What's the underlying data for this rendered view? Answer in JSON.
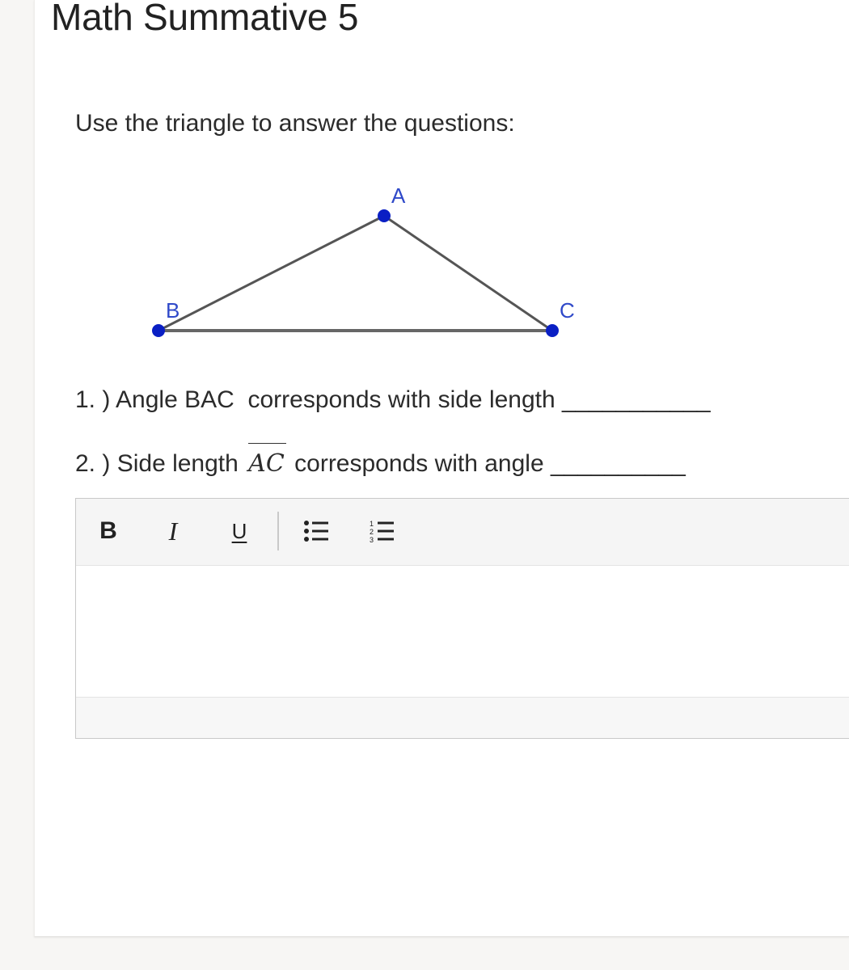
{
  "header": {
    "title": "Math Summative 5"
  },
  "prompt": {
    "instructions": "Use the triangle to answer the questions:"
  },
  "figure": {
    "vertex_labels": {
      "a": "A",
      "b": "B",
      "c": "C"
    },
    "vertex_color": "#0a1fc4",
    "label_color": "#2f49c9",
    "edge_color": "#555555"
  },
  "questions": [
    {
      "number": "1. )",
      "text_before": "Angle BAC  corresponds with side length",
      "blank": "___________"
    },
    {
      "number": "2. )",
      "text_before": "Side length",
      "math": "AC",
      "text_after": "corresponds with angle",
      "blank": "__________"
    }
  ],
  "editor": {
    "toolbar": {
      "bold_label": "B",
      "italic_label": "I",
      "underline_label": "U",
      "bullet_list_icon": "bulleted-list-icon",
      "numbered_list_icon": "numbered-list-icon"
    },
    "content": ""
  }
}
